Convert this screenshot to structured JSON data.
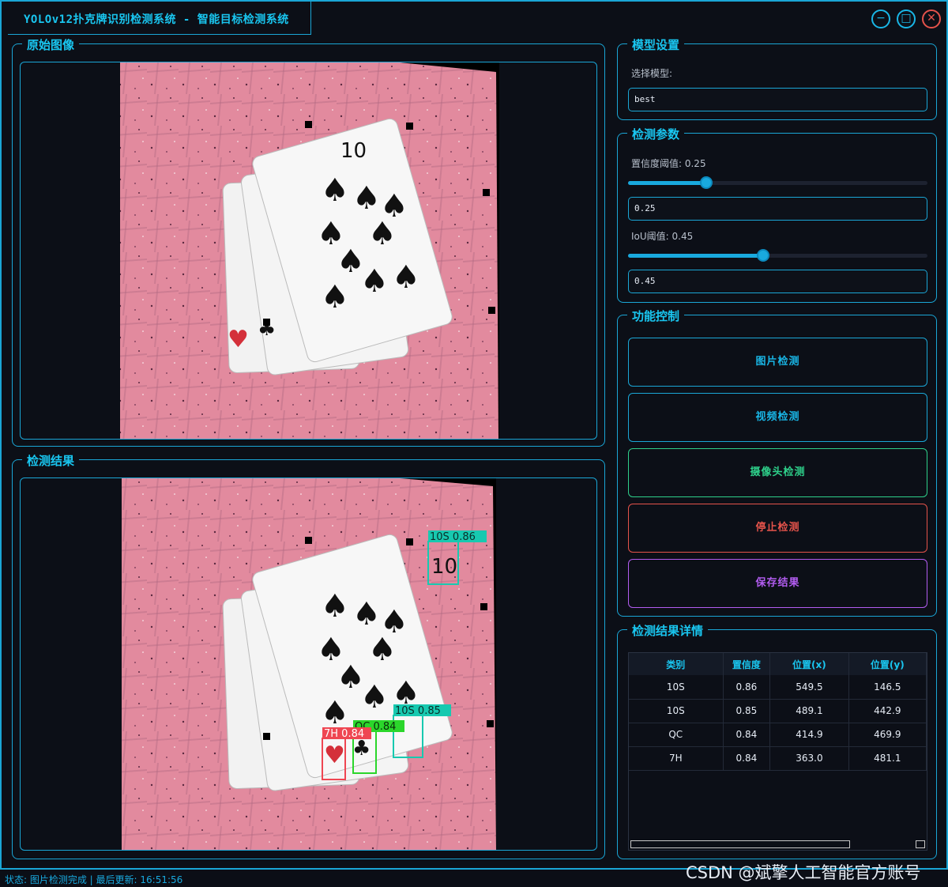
{
  "window": {
    "title": "YOLOv12扑克牌识别检测系统 - 智能目标检测系统",
    "minimize_glyph": "−",
    "maximize_glyph": "□",
    "close_glyph": "✕"
  },
  "panels": {
    "original_title": "原始图像",
    "result_title": "检测结果",
    "model_title": "模型设置",
    "params_title": "检测参数",
    "control_title": "功能控制",
    "details_title": "检测结果详情"
  },
  "model": {
    "select_label": "选择模型:",
    "selected": "best"
  },
  "params": {
    "conf_label": "置信度阈值: 0.25",
    "conf_value": "0.25",
    "conf_level": 0.25,
    "iou_label": "IoU阈值: 0.45",
    "iou_value": "0.45",
    "iou_level": 0.45
  },
  "controls": {
    "image_detect": "图片检测",
    "video_detect": "视频检测",
    "camera_detect": "摄像头检测",
    "stop_detect": "停止检测",
    "save_result": "保存结果"
  },
  "colors": {
    "accent": "#19c6f0",
    "cyan_btn": "#19b6e6",
    "green_btn": "#2ecf8a",
    "red_btn": "#e5534b",
    "purple_btn": "#b25cf0"
  },
  "table": {
    "headers": [
      "类别",
      "置信度",
      "位置(x)",
      "位置(y)"
    ],
    "rows": [
      [
        "10S",
        "0.86",
        "549.5",
        "146.5"
      ],
      [
        "10S",
        "0.85",
        "489.1",
        "442.9"
      ],
      [
        "QC",
        "0.84",
        "414.9",
        "469.9"
      ],
      [
        "7H",
        "0.84",
        "363.0",
        "481.1"
      ]
    ]
  },
  "detections": [
    {
      "label": "10S 0.86"
    },
    {
      "label": "10S 0.85"
    },
    {
      "label": "QC 0.84"
    },
    {
      "label": "7H 0.84"
    }
  ],
  "status": "状态: 图片检测完成 | 最后更新: 16:51:56",
  "watermark": "CSDN @斌擎人工智能官方账号"
}
